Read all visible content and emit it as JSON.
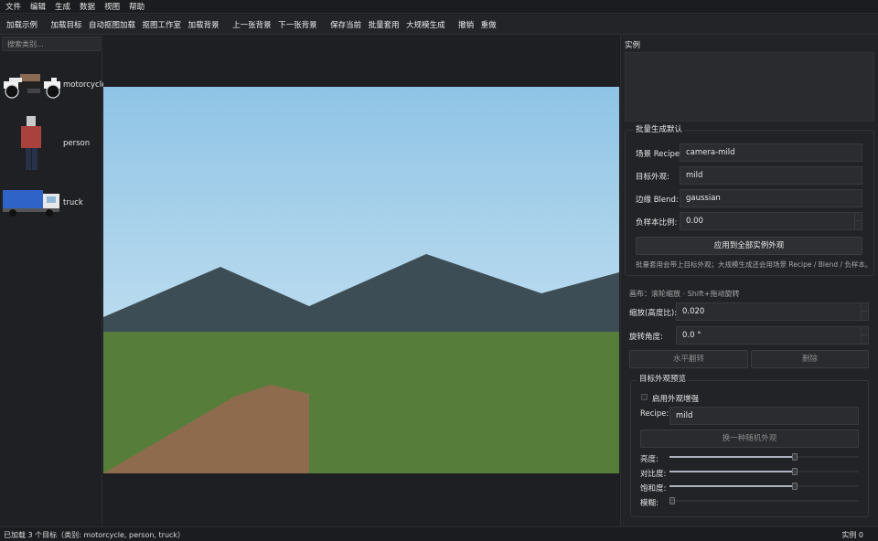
{
  "menu": [
    "文件",
    "编辑",
    "生成",
    "数据",
    "视图",
    "帮助"
  ],
  "toolbar": {
    "load_example": "加载示例",
    "load_target": "加载目标",
    "auto_load": "自动抠图加载",
    "matting_studio": "抠图工作室",
    "load_background": "加载背景",
    "prev_background": "上一张背景",
    "next_background": "下一张背景",
    "save_current": "保存当前",
    "batch_apply": "批量套用",
    "large_scale": "大规模生成",
    "undo": "撤销",
    "redo": "重做"
  },
  "sidebar": {
    "search_placeholder": "搜索类别...",
    "categories": [
      {
        "label": "motorcycle"
      },
      {
        "label": "person"
      },
      {
        "label": "truck"
      }
    ]
  },
  "right": {
    "instances_title": "实例",
    "batch_group_title": "批量生成默认",
    "scene_recipe_label": "场景 Recipe:",
    "scene_recipe_value": "camera-mild",
    "target_appearance_label": "目标外观:",
    "target_appearance_value": "mild",
    "edge_blend_label": "边缘 Blend:",
    "edge_blend_value": "gaussian",
    "negative_ratio_label": "负样本比例:",
    "negative_ratio_value": "0.00",
    "apply_all_button": "应用到全部实例外观",
    "batch_hint": "批量套用会带上目标外观；大规模生成还会用场景 Recipe / Blend / 负样本。",
    "canvas_hint": "画布：滚轮缩放 · Shift+拖动旋转",
    "scale_label": "缩放(高度比):",
    "scale_value": "0.020",
    "rotation_label": "旋转角度:",
    "rotation_value": "0.0 °",
    "flip_button": "水平翻转",
    "delete_button": "删除",
    "preview_group_title": "目标外观预览",
    "enable_aug_label": "启用外观增强",
    "recipe_label": "Recipe:",
    "recipe_value": "mild",
    "random_button": "换一种随机外观",
    "brightness_label": "亮度:",
    "brightness_value": 0.66,
    "contrast_label": "对比度:",
    "contrast_value": 0.66,
    "saturation_label": "饱和度:",
    "saturation_value": 0.66,
    "blur_label": "模糊:",
    "blur_value": 0.0
  },
  "status": {
    "left": "已加载 3 个目标（类别: motorcycle, person, truck）",
    "right": "实例 0"
  },
  "colors": {
    "sky_top": "#8fc4e6",
    "sky_bottom": "#bcdcef",
    "mountain": "#3d4d55",
    "grass": "#567e3a",
    "dirt": "#8e6b4d"
  }
}
